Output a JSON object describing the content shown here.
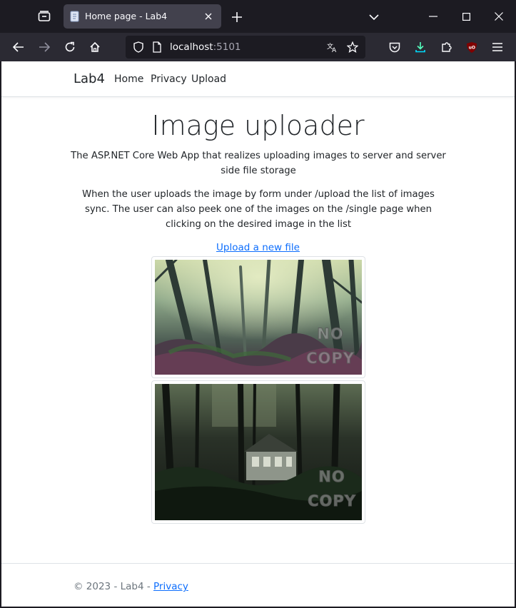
{
  "browser": {
    "tab_title": "Home page - Lab4",
    "url_host": "localhost",
    "url_port": ":5101"
  },
  "site": {
    "brand": "Lab4",
    "nav": [
      "Home",
      "Privacy",
      "Upload"
    ]
  },
  "main": {
    "title": "Image uploader",
    "intro": "The ASP.NET Core Web App that realizes uploading images to server and server side file storage",
    "description": "When the user uploads the image by form under /upload the list of images sync. The user can also peek one of the images on the /single page when clicking on the desired image in the list",
    "upload_link": "Upload a new file",
    "images": [
      {
        "watermark_line1": "NO",
        "watermark_line2": "COPY",
        "subject": "misty forest"
      },
      {
        "watermark_line1": "NO",
        "watermark_line2": "COPY",
        "subject": "house in dark forest"
      }
    ]
  },
  "footer": {
    "copyright": "© 2023 - Lab4 - ",
    "privacy_link": "Privacy"
  }
}
